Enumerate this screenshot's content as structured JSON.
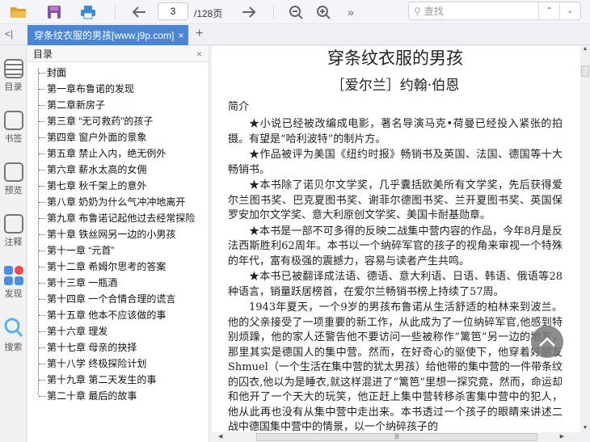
{
  "toolbar": {
    "page_current": "3",
    "page_total": "/128页",
    "search_placeholder": "查找",
    "more": "»"
  },
  "tab": {
    "title": "穿条纹衣服的男孩[www.j9p.com]",
    "close": "×",
    "add": "+",
    "collapse": "<|"
  },
  "rail": [
    {
      "label": "目录",
      "icon": "toc-icon"
    },
    {
      "label": "书签",
      "icon": "bookmark-icon"
    },
    {
      "label": "预览",
      "icon": "preview-icon"
    },
    {
      "label": "注释",
      "icon": "note-icon"
    },
    {
      "label": "发现",
      "icon": "discover-icon"
    },
    {
      "label": "搜索",
      "icon": "search-icon"
    }
  ],
  "toc": {
    "title": "目录",
    "close": "×",
    "items": [
      "封面",
      "第一章布鲁诺的发现",
      "第二章新房子",
      "第三章 “无可救药”的孩子",
      "第四章 窗户外面的景象",
      "第五章 禁止入内，绝无例外",
      "第六章 薪水太高的女佣",
      "第七章 秋千架上的意外",
      "第八章 奶奶为什么气冲冲地离开",
      "第九章 布鲁诺记起他过去经常探险",
      "第十章 铁丝网另一边的小男孩",
      "第十一章 “元首”",
      "第十二章 希姆尔思考的答案",
      "第十三章 一瓶酒",
      "第十四章 一个合情合理的谎言",
      "第十五章 他本不应该做的事",
      "第十六章 理发",
      "第十七章 母亲的抉择",
      "第十八学 终极探险计划",
      "第十九章 第二天发生的事",
      "第二十章 最后的故事"
    ]
  },
  "document": {
    "title": "穿条纹衣服的男孩",
    "author": "［爱尔兰］约翰·伯恩",
    "intro": "简介",
    "paragraphs": [
      "★小说已经被改编成电影，著名导演马克•荷曼已经投入紧张的拍摄。有望是“哈利波特”的制片方。",
      "★作品被评为美国《纽约时报》畅销书及英国、法国、德国等十大畅销书。",
      "★本书除了诺贝尔文学奖，几乎囊括欧美所有文学奖，先后获得爱尔兰图书奖、巴克夏图书奖、谢菲尔德图书奖、兰开夏图书奖、英国保罗安加尔文学奖、意大利原创文学奖、美国卡耐基勋章。",
      "★本书是一部不可多得的反映二战集中营内容的作品，今年8月是反法西斯胜利62周年。本书以一个纳碎军官的孩子的视角来审视一个特殊的年代，富有极强的震撼力，容易与读者产生共鸣。",
      "★本书已被翻译成法语、德语、意大利语、日语、韩语、俄语等28种语言，销量跃居榜首，在爱尔兰畅销书榜上持续了57周。",
      "1943年夏天，一个9岁的男孩布鲁诺从生活舒适的柏林来到波兰。他的父亲接受了一项重要的新工作，从此成为了一位纳碎军官,他感到特别烦躁，他的家人还警告他不要访问一些被称作“篱笆”另一边的地方，那里其实是德国人的集中营。然而，在好奇心的驱使下，他穿着好朋友Shmuel（一个生活在集中营的犹太男孩）给他带的集中营的一件带条纹的囚衣,他以为是睡衣,就这样混进了“篱笆”里想一探究竟，然而，命运却和他开了一个天大的玩笑，他正赶上集中营转移杀害集中营中的犯人，他从此再也没有从集中营中走出来。本书透过一个孩子的眼睛来讲述二战中德国集中营中的情景，以一个纳碎孩子的"
    ]
  },
  "colors": {
    "accent": "#4a86d4"
  }
}
